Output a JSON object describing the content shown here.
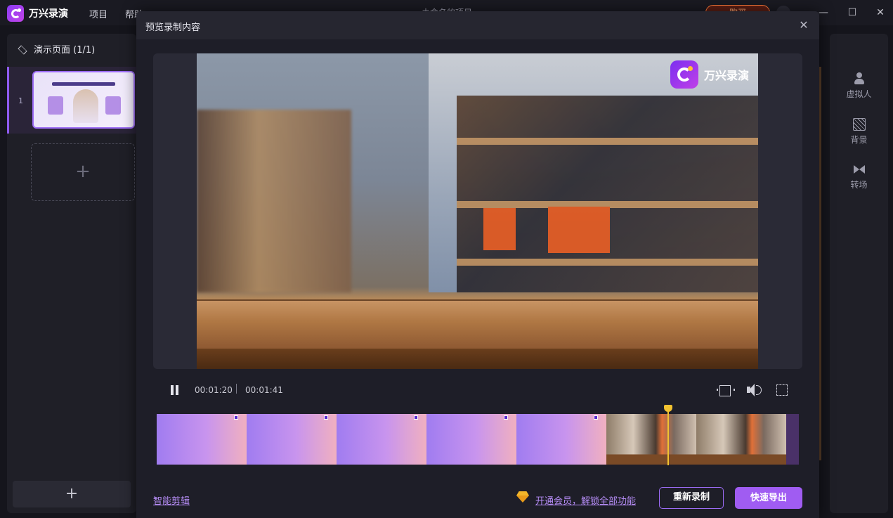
{
  "app": {
    "name": "万兴录演",
    "menu": [
      "项目",
      "帮助"
    ],
    "project_title": "未命名的项目",
    "buy_label": "购买"
  },
  "window_controls": {
    "minimize": "—",
    "maximize": "☐",
    "close": "✕"
  },
  "left_panel": {
    "header": "演示页面 (1/1)",
    "slides": [
      {
        "number": "1"
      }
    ],
    "add_symbol": "+"
  },
  "right_panel": {
    "items": [
      {
        "label": "虚拟人",
        "icon": "avatar-icon"
      },
      {
        "label": "背景",
        "icon": "background-icon"
      },
      {
        "label": "转场",
        "icon": "transition-icon"
      }
    ]
  },
  "modal": {
    "title": "预览录制内容",
    "close_symbol": "✕",
    "video_logo_text": "万兴录演",
    "player": {
      "current_time": "00:01:20",
      "total_time": "00:01:41",
      "progress_fraction": 0.79
    },
    "timeline": {
      "frames": [
        "purple",
        "purple",
        "purple",
        "purple",
        "purple",
        "room",
        "room"
      ]
    },
    "footer": {
      "smart_edit": "智能剪辑",
      "vip_text": "开通会员，解锁全部功能",
      "rerecord": "重新录制",
      "export": "快速导出"
    }
  },
  "colors": {
    "accent": "#a05cf2",
    "playhead": "#f2c230",
    "link": "#b58cf5",
    "buy_border": "#ff7a3c"
  }
}
